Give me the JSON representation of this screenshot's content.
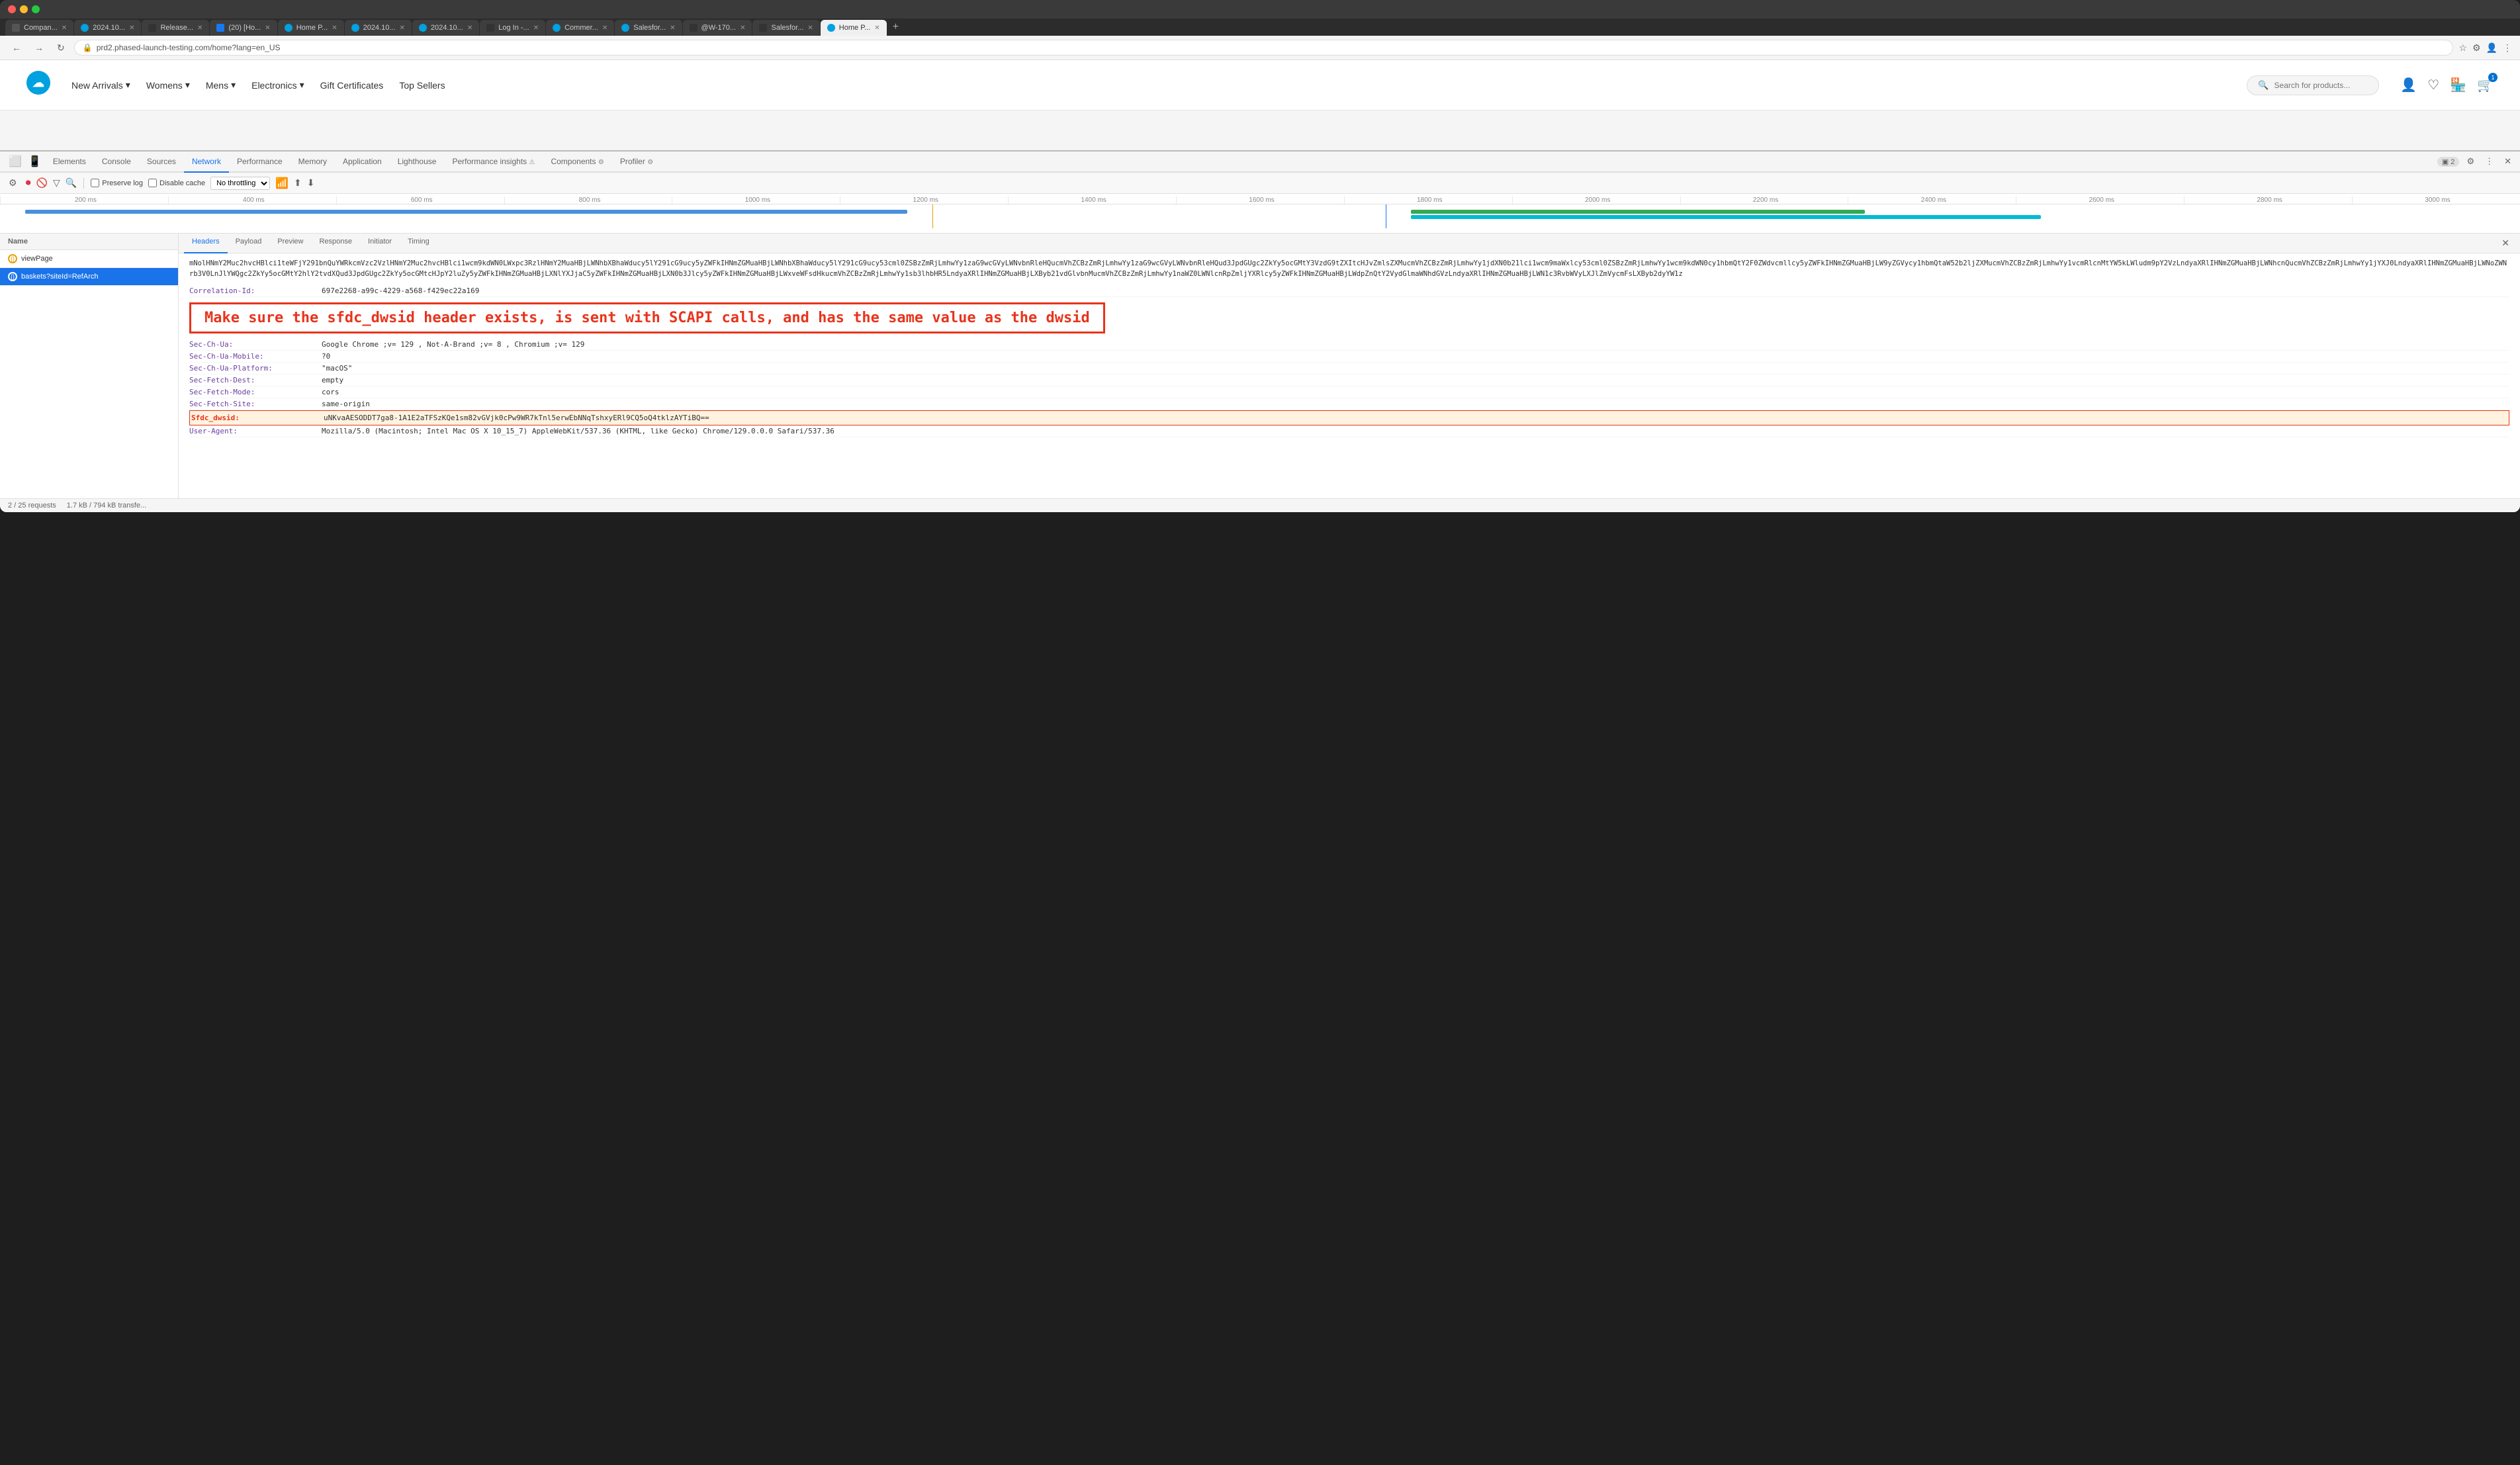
{
  "browser": {
    "tabs": [
      {
        "id": 1,
        "label": "Compan...",
        "favicon_color": "#333",
        "active": false
      },
      {
        "id": 2,
        "label": "2024.10...",
        "favicon_color": "#00a1e0",
        "active": false
      },
      {
        "id": 3,
        "label": "Release...",
        "favicon_color": "#333",
        "active": false
      },
      {
        "id": 4,
        "label": "(20) [Ho...",
        "favicon_color": "#1877f2",
        "active": false
      },
      {
        "id": 5,
        "label": "Home P...",
        "favicon_color": "#00a1e0",
        "active": false
      },
      {
        "id": 6,
        "label": "2024.10...",
        "favicon_color": "#00a1e0",
        "active": false
      },
      {
        "id": 7,
        "label": "2024.10...",
        "favicon_color": "#00a1e0",
        "active": false
      },
      {
        "id": 8,
        "label": "Log In -...",
        "favicon_color": "#333",
        "active": false
      },
      {
        "id": 9,
        "label": "Commer...",
        "favicon_color": "#00a1e0",
        "active": false
      },
      {
        "id": 10,
        "label": "Salesfor...",
        "favicon_color": "#333",
        "active": false
      },
      {
        "id": 11,
        "label": "@W-170...",
        "favicon_color": "#333",
        "active": false
      },
      {
        "id": 12,
        "label": "Salesfor...",
        "favicon_color": "#333",
        "active": false
      },
      {
        "id": 13,
        "label": "Home P...",
        "favicon_color": "#00a1e0",
        "active": true
      }
    ],
    "url": "prd2.phased-launch-testing.com/home?lang=en_US"
  },
  "website": {
    "nav": {
      "new_arrivals": "New Arrivals",
      "womens": "Womens",
      "mens": "Mens",
      "electronics": "Electronics",
      "gift_certificates": "Gift Certificates",
      "top_sellers": "Top Sellers"
    },
    "search_placeholder": "Search for products...",
    "cart_count": "1"
  },
  "devtools": {
    "tabs": [
      {
        "label": "Elements",
        "active": false
      },
      {
        "label": "Console",
        "active": false
      },
      {
        "label": "Sources",
        "active": false
      },
      {
        "label": "Network",
        "active": true
      },
      {
        "label": "Performance",
        "active": false
      },
      {
        "label": "Memory",
        "active": false
      },
      {
        "label": "Application",
        "active": false
      },
      {
        "label": "Lighthouse",
        "active": false
      },
      {
        "label": "Performance insights",
        "active": false
      },
      {
        "label": "Components",
        "active": false
      },
      {
        "label": "Profiler",
        "active": false
      }
    ],
    "network": {
      "preserve_log": "Preserve log",
      "disable_cache": "Disable cache",
      "throttle": "No throttling",
      "timeline_ticks": [
        "200 ms",
        "400 ms",
        "600 ms",
        "800 ms",
        "1000 ms",
        "1200 ms",
        "1400 ms",
        "1600 ms",
        "1800 ms",
        "2000 ms",
        "2200 ms",
        "2400 ms",
        "2600 ms",
        "2800 ms",
        "3000 ms"
      ],
      "requests": [
        {
          "name": "viewPage",
          "active": false
        },
        {
          "name": "baskets?siteId=RefArch",
          "active": true
        }
      ],
      "details_tabs": [
        "Headers",
        "Payload",
        "Preview",
        "Response",
        "Initiator",
        "Timing"
      ],
      "active_detail_tab": "Headers",
      "long_value": "mNolHNmY2Muc2hvcHBlci1teWFjY291bnQuYWRkcmVzc2VzlHNmY2Muc2hvcHBlci1wcm9kdWN0LWxpc3RzlHNmY2MuaHBjLWNhbXBhaWducy5lY291cG9ucy5yZWFkIHNmZGMuaHBjLWNhbXBhaWducy5lY291cG9ucy53cml0ZSBzZmRjLmhwYy1zaG9wcGVyLWNvbnRleHQucmVhZCBzZmRjLmhwYy1zaG9wcGVyLWNvbnRleHQud3JpdGUgc2ZkYy5ocGMtY3VzdG9tZXItcHJvZmlsZXMucmVhZCBzZmRjLmhwYy1jdXN0b21lci1wcm9maWxlcy53cml0ZSBzZmRjLmhwYy1wcm9kdWN0cy1hbmQtY2F0ZWdvcmllcy5yZWFkIHNmZGMuaHBjLW9yZGVycy1hbmQtaW52b2ljZXMucmVhZCBzZmRjLmhwYy1vcmRlcnMtYW5kLWludm9pY2VzLndyaXRlIHNmZGMuaHBjLWNhcnQucmVhZCBzZmRjLmhwYy1jYXJ0LndyaXRlIHNmZGMuaHBjLWNoZWNrb3V0LnJlYWQgc2ZkYy5ocGMtY2hlY2tvdXQud3JpdGUgc2ZkYy5ocGMtcHJpY2luZy5yZWFkIHNmZGMuaHBjLXNlYXJjaC5yZWFkIHNmZGMuaHBjLXN0b3Jlcy5yZWFkIHNmZGMuaHBjLWxveWFsdHkucmVhZCBzZmRjLmhwYy1sb3lhbHR5LndyaXRlIHNmZGMuaHBjLXByb21vdGlvbnMucmVhZCBzZmRjLmhwYy1naWZ0LWNlcnRpZmljYXRlcy5yZWFkIHNmZGMuaHBjLWdpZnQtY2VydGlmaWNhdGVzLndyaXRlIHNmZGMuaHBjLWN1c3RvbWVyLXJlZmVycmFsLXByb2dyYW1z",
      "correlation_id_label": "Correlation-Id:",
      "correlation_id_value": "697e2268-a99c-4229-a568-f429ec22a169",
      "annotation_text": "Make sure the sfdc_dwsid header exists, is sent with SCAPI calls, and has the same value as the dwsid",
      "headers": [
        {
          "name": "Sec-Ch-Ua:",
          "value": "Google Chrome ;v= 129 , Not-A-Brand ;v= 8 , Chromium ;v= 129"
        },
        {
          "name": "Sec-Ch-Ua-Mobile:",
          "value": "?0"
        },
        {
          "name": "Sec-Ch-Ua-Platform:",
          "value": "\"macOS\""
        },
        {
          "name": "Sec-Fetch-Dest:",
          "value": "empty"
        },
        {
          "name": "Sec-Fetch-Mode:",
          "value": "cors"
        },
        {
          "name": "Sec-Fetch-Site:",
          "value": "same-origin"
        },
        {
          "name": "Sfdc_dwsid:",
          "value": "uNKvaAESODDT7ga8-1A1E2aTFSzKQe1sm82vGVjk0cPw9WR7kTnl5erwEbNNqTshxyERl9CQ5oQ4tklzAYTiBQ==",
          "highlighted": true
        },
        {
          "name": "User-Agent:",
          "value": "Mozilla/5.0 (Macintosh; Intel Mac OS X 10_15_7) AppleWebKit/537.36 (KHTML, like Gecko) Chrome/129.0.0.0 Safari/537.36"
        }
      ],
      "status_bar": {
        "requests": "2 / 25 requests",
        "transferred": "1.7 kB / 794 kB transfe..."
      }
    }
  }
}
